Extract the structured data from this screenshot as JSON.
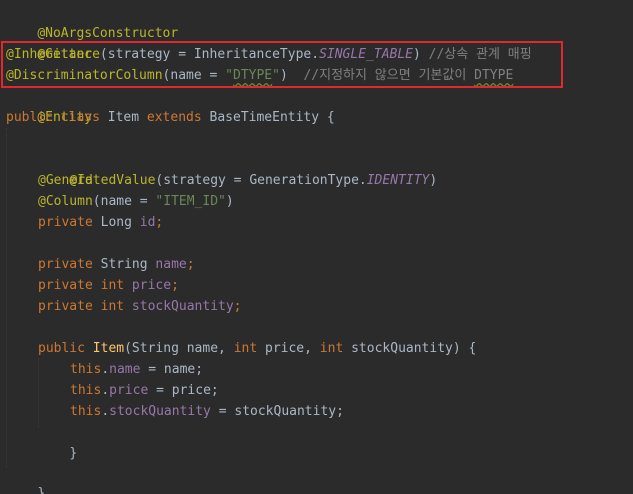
{
  "code": {
    "l1_ann": "@NoArgsConstructor",
    "l2_ann": "@Getter",
    "l3_ann": "@Inheritance",
    "l3_p1": "(strategy = InheritanceType.",
    "l3_const": "SINGLE_TABLE",
    "l3_p2": ") ",
    "l3_cmt": "//상속 관계 매핑",
    "l4_ann": "@DiscriminatorColumn",
    "l4_p1": "(name = ",
    "l4_str1": "\"",
    "l4_str2": "DTYPE",
    "l4_str3": "\"",
    "l4_p2": ")  ",
    "l4_cmt1": "//지정하지 않으면 기본값이 ",
    "l4_cmt2": "DTYPE",
    "l5_ann": "@Entity",
    "l6_kw1": "public class ",
    "l6_name": "Item ",
    "l6_kw2": "extends ",
    "l6_rest": "BaseTimeEntity {",
    "l8_ann": "@Id",
    "l9_ann": "@GeneratedValue",
    "l9_p1": "(strategy = GenerationType.",
    "l9_const": "IDENTITY",
    "l9_p2": ")",
    "l10_ann": "@Column",
    "l10_p1": "(name = ",
    "l10_str": "\"ITEM_ID\"",
    "l10_p2": ")",
    "l11_kw": "private ",
    "l11_type": "Long ",
    "l11_field": "id",
    "l11_semi": ";",
    "l13_kw": "private ",
    "l13_type": "String ",
    "l13_field": "name",
    "l13_semi": ";",
    "l14_kw": "private int ",
    "l14_field": "price",
    "l14_semi": ";",
    "l15_kw": "private int ",
    "l15_field": "stockQuantity",
    "l15_semi": ";",
    "l17_kw": "public ",
    "l17_fn": "Item",
    "l17_p1": "(String name, ",
    "l17_kw2": "int ",
    "l17_p2": "price, ",
    "l17_kw3": "int ",
    "l17_p3": "stockQuantity) {",
    "l18_kw": "this",
    "l18_dot": ".",
    "l18_field": "name",
    "l18_rest": " = name;",
    "l19_kw": "this",
    "l19_dot": ".",
    "l19_field": "price",
    "l19_rest": " = price;",
    "l20_kw": "this",
    "l20_dot": ".",
    "l20_field": "stockQuantity",
    "l20_rest": " = stockQuantity;",
    "l21": "}",
    "l23": "}"
  },
  "colors": {
    "background": "#2b2b2b",
    "highlight_border": "#e0282e"
  }
}
